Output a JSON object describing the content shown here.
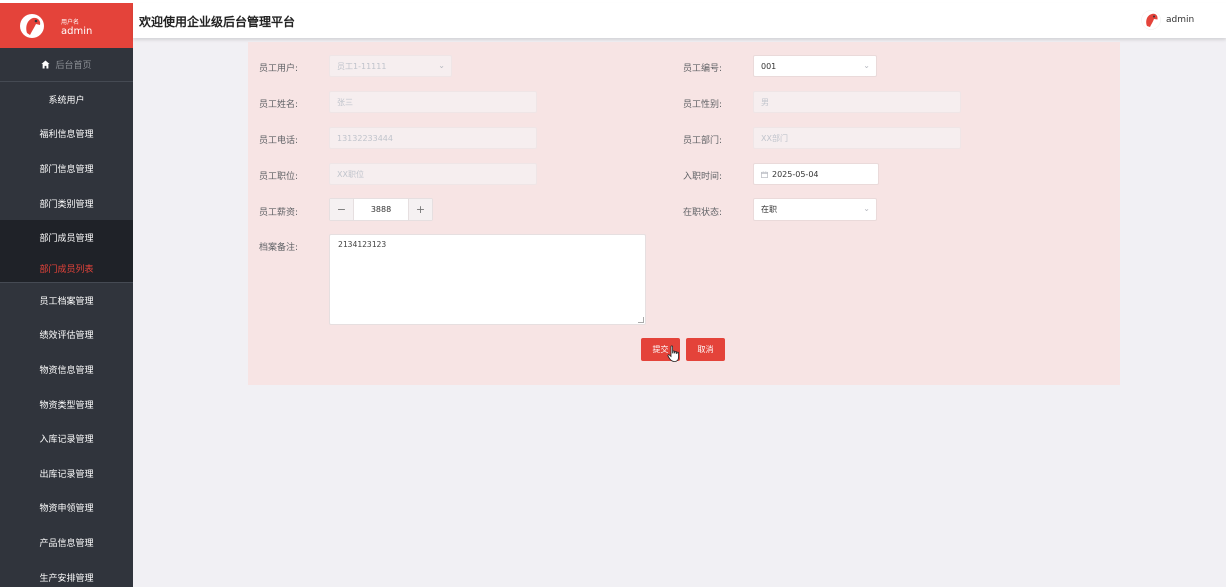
{
  "sidebar": {
    "brand_label": "用户名",
    "brand_user": "admin",
    "home": "后台首页",
    "items": [
      {
        "label": "系统用户",
        "dark": false
      },
      {
        "label": "福利信息管理",
        "dark": false
      },
      {
        "label": "部门信息管理",
        "dark": false
      },
      {
        "label": "部门类别管理",
        "dark": false
      },
      {
        "label": "部门成员管理",
        "dark": true
      }
    ],
    "active_sub": "部门成员列表",
    "items_after": [
      "员工档案管理",
      "绩效评估管理",
      "物资信息管理",
      "物资类型管理",
      "入库记录管理",
      "出库记录管理",
      "物资申领管理",
      "产品信息管理",
      "生产安排管理"
    ]
  },
  "header": {
    "title": "欢迎使用企业级后台管理平台",
    "user": "admin"
  },
  "form": {
    "employee_user_label": "员工用户:",
    "employee_user_value": "员工1-11111",
    "employee_no_label": "员工编号:",
    "employee_no_value": "001",
    "name_label": "员工姓名:",
    "name_value": "张三",
    "gender_label": "员工性别:",
    "gender_value": "男",
    "phone_label": "员工电话:",
    "phone_value": "13132233444",
    "dept_label": "员工部门:",
    "dept_value": "XX部门",
    "position_label": "员工职位:",
    "position_value": "XX职位",
    "hire_date_label": "入职时间:",
    "hire_date_value": "2025-05-04",
    "salary_label": "员工薪资:",
    "salary_value": "3888",
    "status_label": "在职状态:",
    "status_value": "在职",
    "remarks_label": "档案备注:",
    "remarks_value": "2134123123",
    "submit": "提交",
    "cancel": "取消"
  },
  "colors": {
    "accent": "#e4433a",
    "sidebar_bg": "#30343c",
    "panel_bg": "#f7e4e4"
  }
}
